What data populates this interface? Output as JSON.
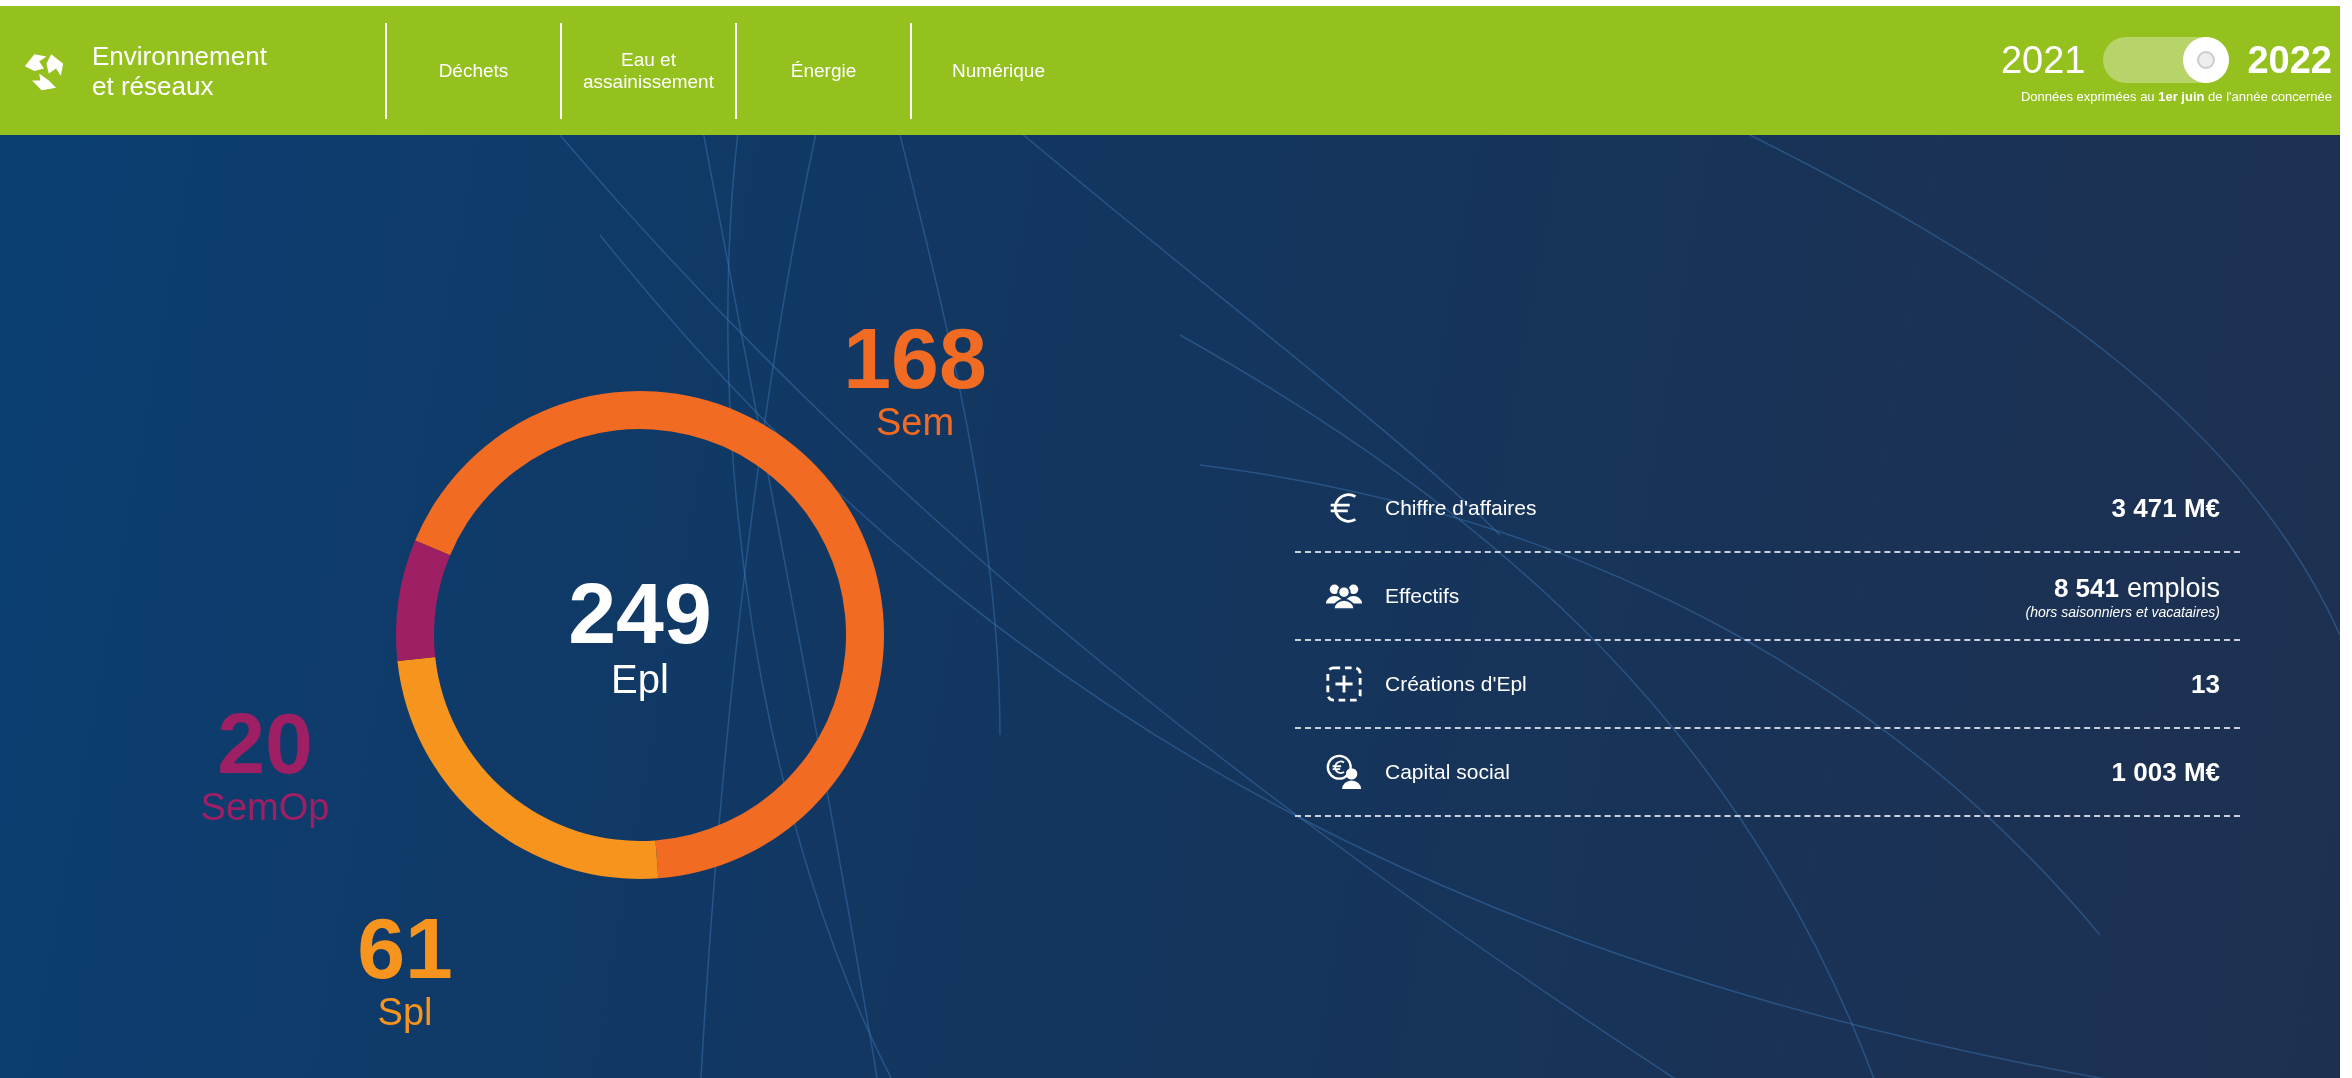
{
  "header": {
    "title": [
      "Environnement",
      "et réseaux"
    ],
    "nav": [
      {
        "label": "Déchets",
        "selected": false
      },
      {
        "label": "Eau et assainissement",
        "selected": false
      },
      {
        "label": "Énergie",
        "selected": false
      },
      {
        "label": "Numérique",
        "selected": false
      }
    ],
    "year_toggle": {
      "years": [
        {
          "label": "2021",
          "selected": false
        },
        {
          "label": "2022",
          "selected": true
        }
      ],
      "note": "Données exprimées au **1er juin** de l'année concernée"
    }
  },
  "donut": {
    "total": "249",
    "chart_data": {
      "type": "donut",
      "categories": [
        "Sem",
        "Spl",
        "SemOp"
      ],
      "colors": [
        "#f26b22",
        "#f7941d",
        "#9e1f63"
      ],
      "series": [
        {
          "name": "Epl",
          "values": [
            168,
            61,
            20
          ]
        }
      ],
      "data_labels": true
    }
  },
  "stats": [
    {
      "label": "Chiffre d'affaires",
      "value": "3 471 M€"
    },
    {
      "label": "Effectifs",
      "value": "8 541",
      "unit": "emplois",
      "note": "(hors saisonniers et vacataires)"
    },
    {
      "label": "Créations d'Epl",
      "value": "13"
    },
    {
      "label": "Capital social",
      "value": "1 003 M€"
    }
  ]
}
